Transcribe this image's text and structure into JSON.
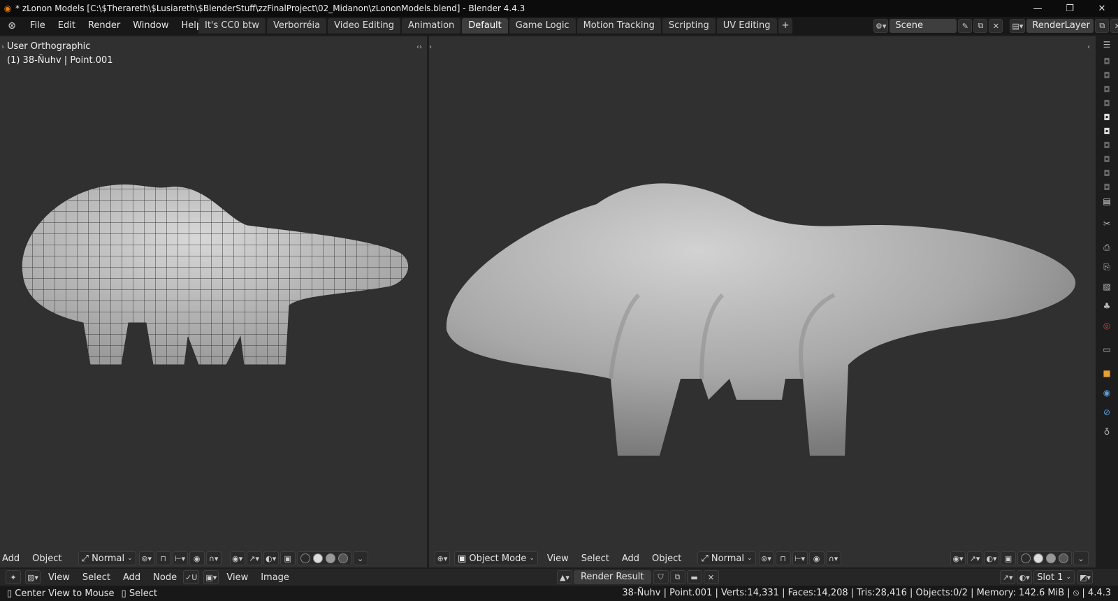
{
  "window": {
    "title": "* zLonon Models [C:\\$Therareth\\$Lusiareth\\$BlenderStuff\\zzFinalProject\\02_Midanon\\zLononModels.blend] - Blender 4.4.3",
    "minimize_icon": "minimize-icon",
    "maximize_icon": "maximize-icon",
    "close_icon": "close-icon"
  },
  "menubar": {
    "items": [
      "File",
      "Edit",
      "Render",
      "Window",
      "Help"
    ]
  },
  "workspaces": {
    "tabs": [
      "It's CC0 btw",
      "Verborréia",
      "Video Editing",
      "Animation",
      "Default",
      "Game Logic",
      "Motion Tracking",
      "Scripting",
      "UV Editing"
    ],
    "active": "Default",
    "add_label": "+"
  },
  "scene": {
    "scene_name": "Scene",
    "view_layer": "RenderLayer"
  },
  "viewport_left": {
    "view_label": "User Orthographic",
    "object_label": "(1) 38-Ñuhv | Point.001",
    "header": {
      "add": "Add",
      "object": "Object",
      "orientation": "Normal"
    }
  },
  "viewport_right": {
    "header": {
      "mode": "Object Mode",
      "view": "View",
      "select": "Select",
      "add": "Add",
      "object": "Object",
      "orientation": "Normal"
    }
  },
  "image_editor": {
    "view": "View",
    "select": "Select",
    "add": "Add",
    "node": "Node",
    "view2": "View",
    "image": "Image",
    "render_result": "Render Result",
    "slot": "Slot 1"
  },
  "statusbar": {
    "left_hint": "Center View to Mouse",
    "select_hint": "Select",
    "stats": "38-Ñuhv | Point.001 | Verts:14,331 | Faces:14,208 | Tris:28,416 | Objects:0/2 | Memory: 142.6 MiB | ",
    "version": "4.4.3"
  },
  "colors": {
    "accent_orange": "#e87d0d",
    "viewport_bg": "#303030",
    "header_bg": "#181818"
  }
}
